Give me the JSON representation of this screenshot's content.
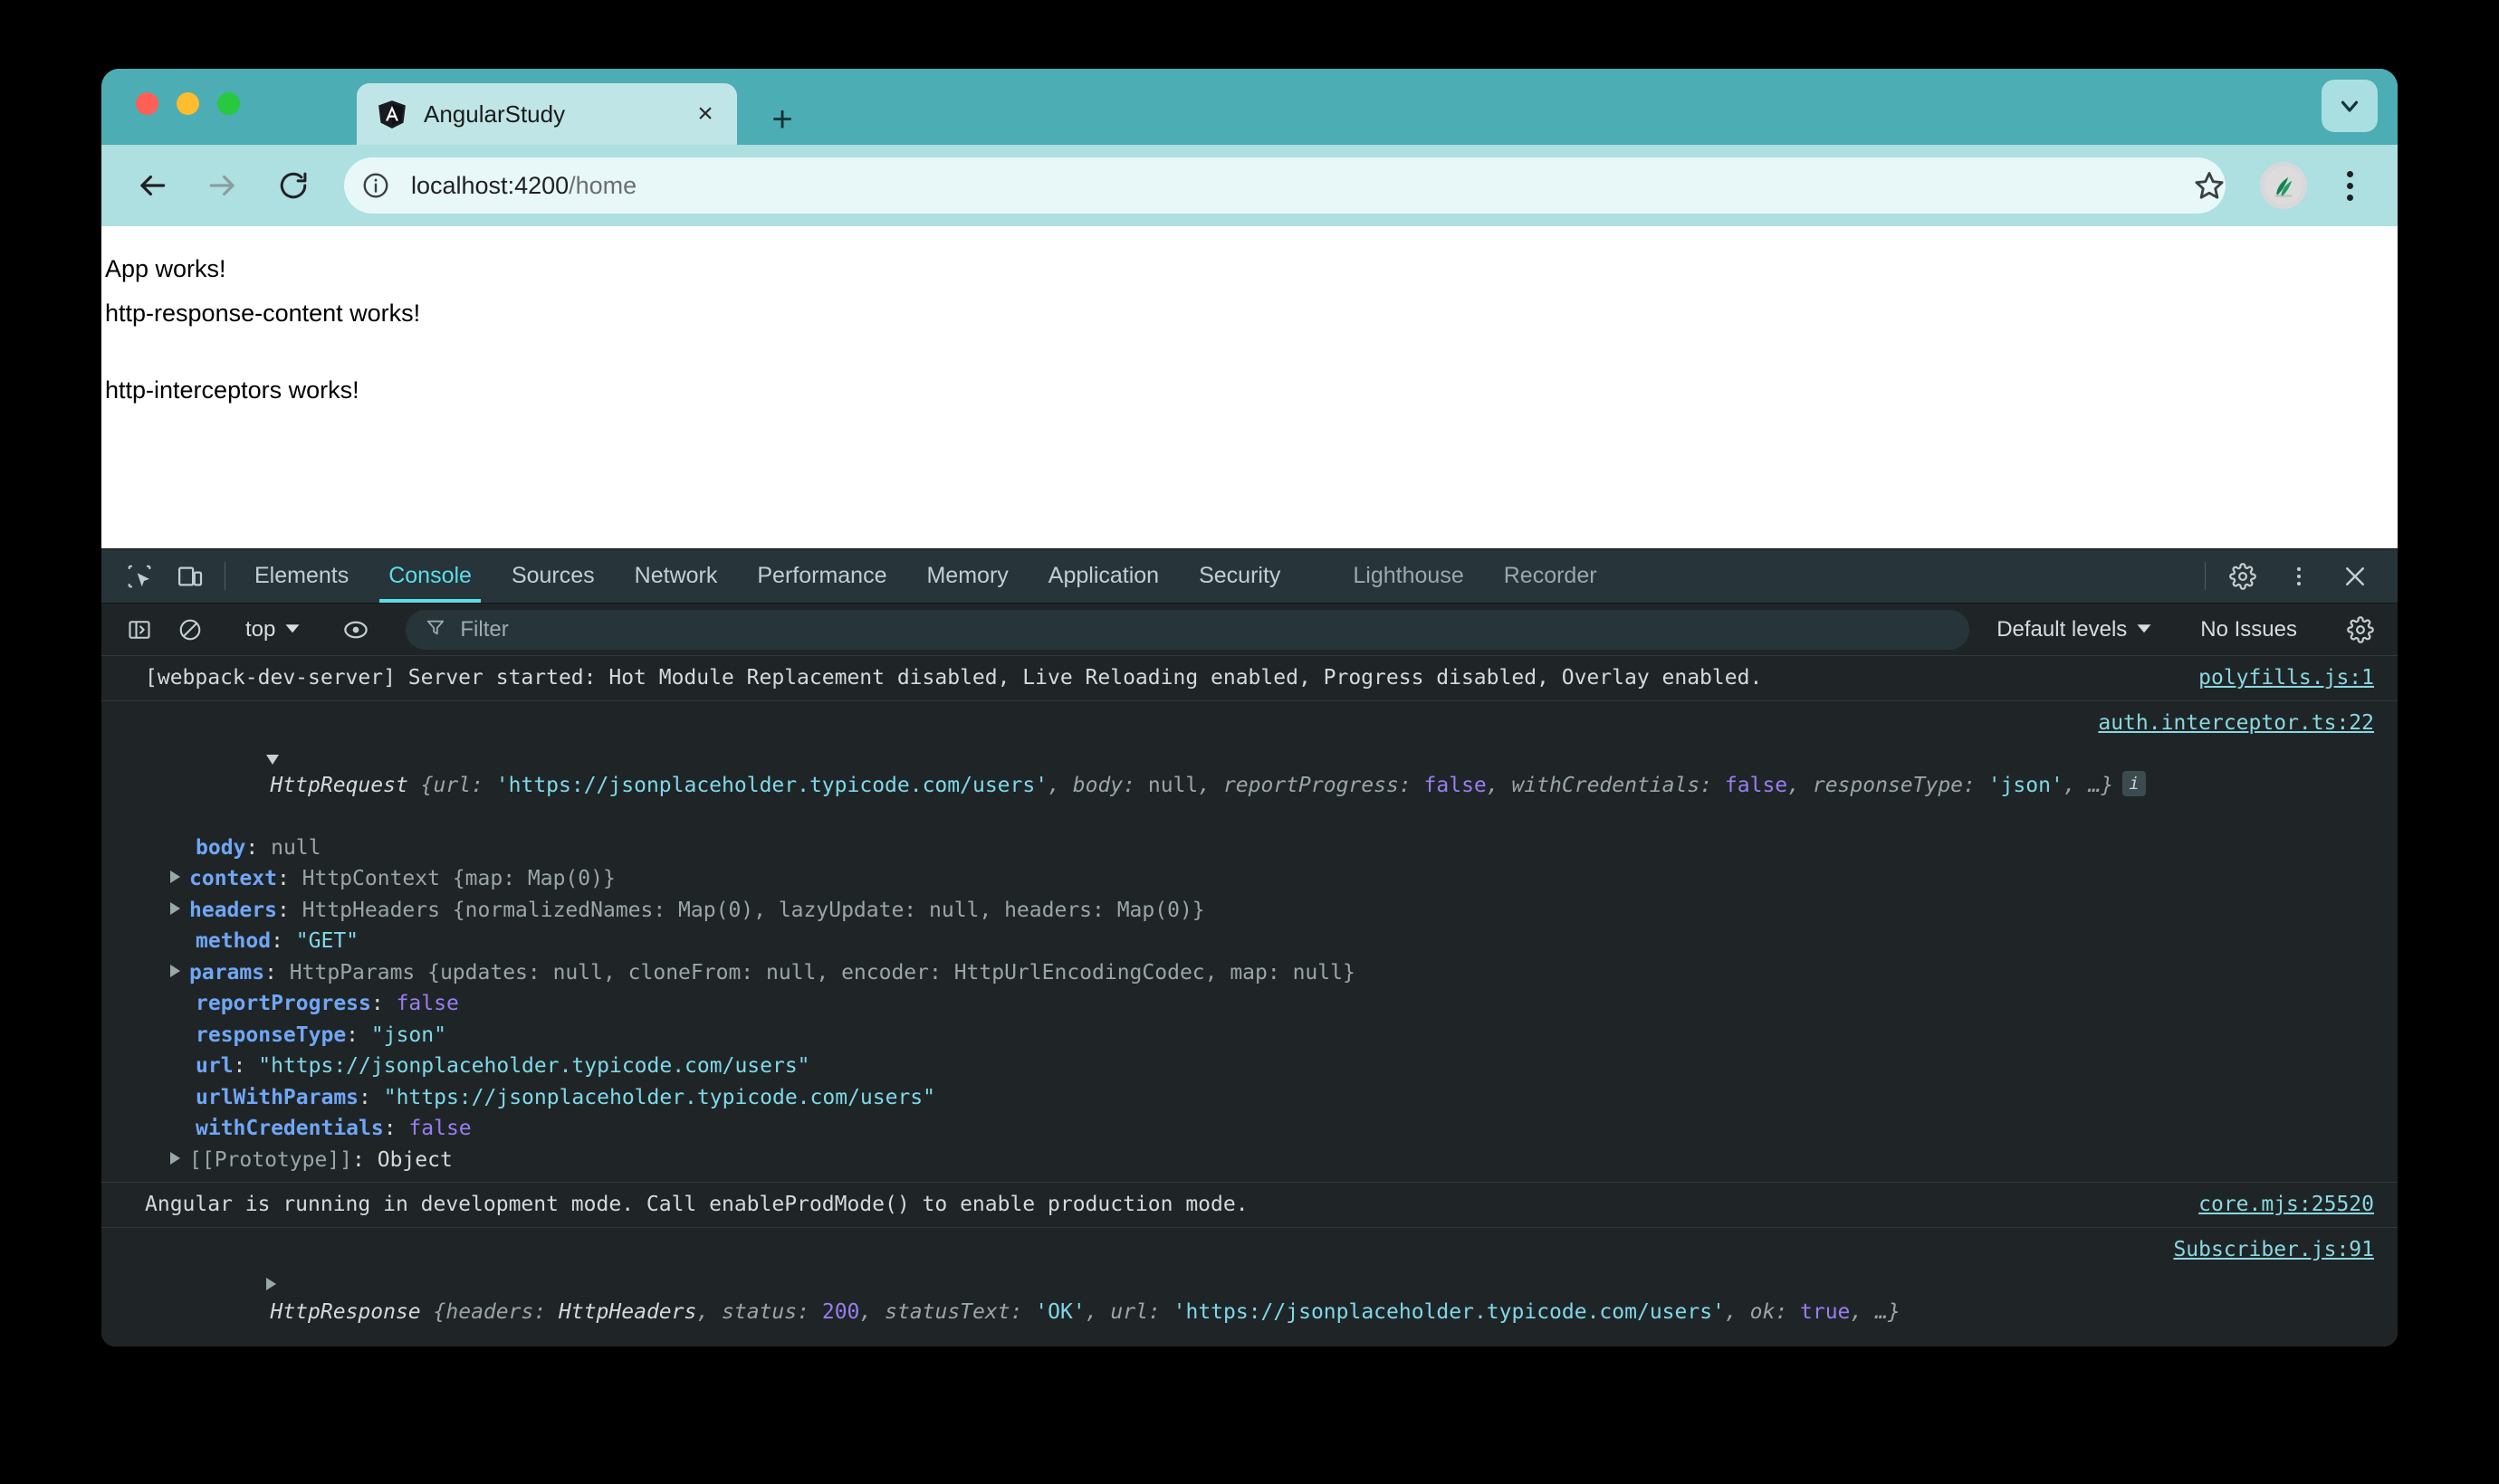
{
  "browser": {
    "tab": {
      "title": "AngularStudy",
      "favicon": "angular-logo-icon",
      "close": "×"
    },
    "new_tab_label": "+",
    "tabstrip_chevron": "chevron-down-icon",
    "nav": {
      "back": "back-arrow-icon",
      "forward": "forward-arrow-icon",
      "reload": "reload-icon",
      "site_info": "info-circle-icon",
      "url_host": "localhost:4200",
      "url_path": "/home",
      "url_full": "localhost:4200/home",
      "bookmark": "star-icon",
      "profile": "profile-avatar-icon",
      "menu": "kebab-menu-icon"
    }
  },
  "page": {
    "lines": [
      "App works!",
      "http-response-content works!",
      "http-interceptors works!"
    ]
  },
  "devtools": {
    "left_icons": [
      "inspect-element-icon",
      "device-toolbar-icon"
    ],
    "tabs": [
      {
        "label": "Elements",
        "active": false,
        "dim": false
      },
      {
        "label": "Console",
        "active": true,
        "dim": false
      },
      {
        "label": "Sources",
        "active": false,
        "dim": false
      },
      {
        "label": "Network",
        "active": false,
        "dim": false
      },
      {
        "label": "Performance",
        "active": false,
        "dim": false
      },
      {
        "label": "Memory",
        "active": false,
        "dim": false
      },
      {
        "label": "Application",
        "active": false,
        "dim": false
      },
      {
        "label": "Security",
        "active": false,
        "dim": false
      },
      {
        "label": "Lighthouse",
        "active": false,
        "dim": true
      },
      {
        "label": "Recorder",
        "active": false,
        "dim": true
      }
    ],
    "right_icons": [
      "gear-icon",
      "kebab-menu-icon",
      "close-icon"
    ],
    "console_toolbar": {
      "sidebar_toggle": "console-sidebar-icon",
      "clear": "clear-console-icon",
      "context": "top",
      "context_chevron": "chevron-down-icon",
      "eye": "live-expression-icon",
      "filter_icon": "filter-funnel-icon",
      "filter_placeholder": "Filter",
      "filter_value": "",
      "levels": "Default levels",
      "levels_chevron": "chevron-down-icon",
      "issues": "No Issues",
      "settings": "gear-icon"
    },
    "console": {
      "messages": [
        {
          "id": "webpack-msg",
          "text": "[webpack-dev-server] Server started: Hot Module Replacement disabled, Live Reloading enabled, Progress disabled, Overlay enabled.",
          "source": "polyfills.js:1"
        },
        {
          "id": "http-request-msg",
          "source": "auth.interceptor.ts:22",
          "header": {
            "ctor": "HttpRequest",
            "open_brace": "{",
            "preview": [
              {
                "key": "url",
                "value": "'https://jsonplaceholder.typicode.com/users'",
                "type": "string"
              },
              {
                "key": "body",
                "value": "null",
                "type": "null"
              },
              {
                "key": "reportProgress",
                "value": "false",
                "type": "bool"
              },
              {
                "key": "withCredentials",
                "value": "false",
                "type": "bool"
              },
              {
                "key": "responseType",
                "value": "'json'",
                "type": "string"
              }
            ],
            "ellipsis": "…}",
            "badge": "i"
          },
          "props": [
            {
              "expandable": false,
              "name": "body",
              "sep": ": ",
              "value": "null",
              "type": "null"
            },
            {
              "expandable": true,
              "name": "context",
              "sep": ": ",
              "value": "HttpContext {map: Map(0)}",
              "type": "objpreview"
            },
            {
              "expandable": true,
              "name": "headers",
              "sep": ": ",
              "value": "HttpHeaders {normalizedNames: Map(0), lazyUpdate: null, headers: Map(0)}",
              "type": "objpreview"
            },
            {
              "expandable": false,
              "name": "method",
              "sep": ": ",
              "value": "\"GET\"",
              "type": "string"
            },
            {
              "expandable": true,
              "name": "params",
              "sep": ": ",
              "value": "HttpParams {updates: null, cloneFrom: null, encoder: HttpUrlEncodingCodec, map: null}",
              "type": "objpreview"
            },
            {
              "expandable": false,
              "name": "reportProgress",
              "sep": ": ",
              "value": "false",
              "type": "bool"
            },
            {
              "expandable": false,
              "name": "responseType",
              "sep": ": ",
              "value": "\"json\"",
              "type": "string"
            },
            {
              "expandable": false,
              "name": "url",
              "sep": ": ",
              "value": "\"https://jsonplaceholder.typicode.com/users\"",
              "type": "string"
            },
            {
              "expandable": false,
              "name": "urlWithParams",
              "sep": ": ",
              "value": "\"https://jsonplaceholder.typicode.com/users\"",
              "type": "string"
            },
            {
              "expandable": false,
              "name": "withCredentials",
              "sep": ": ",
              "value": "false",
              "type": "bool"
            },
            {
              "expandable": true,
              "name": "[[Prototype]]",
              "sep": ": ",
              "value": "Object",
              "type": "proto"
            }
          ]
        },
        {
          "id": "angular-dev-mode-msg",
          "text": "Angular is running in development mode. Call enableProdMode() to enable production mode.",
          "source": "core.mjs:25520"
        },
        {
          "id": "http-response-msg",
          "source": "Subscriber.js:91",
          "header": {
            "ctor": "HttpResponse",
            "open_brace": "{",
            "preview": [
              {
                "key": "headers",
                "value": "HttpHeaders",
                "type": "cls"
              },
              {
                "key": "status",
                "value": "200",
                "type": "num"
              },
              {
                "key": "statusText",
                "value": "'OK'",
                "type": "string"
              },
              {
                "key": "url",
                "value": "'https://jsonplaceholder.typicode.com/users'",
                "type": "string"
              },
              {
                "key": "ok",
                "value": "true",
                "type": "bool"
              }
            ],
            "ellipsis": "…}"
          }
        }
      ],
      "prompt": "›"
    }
  }
}
